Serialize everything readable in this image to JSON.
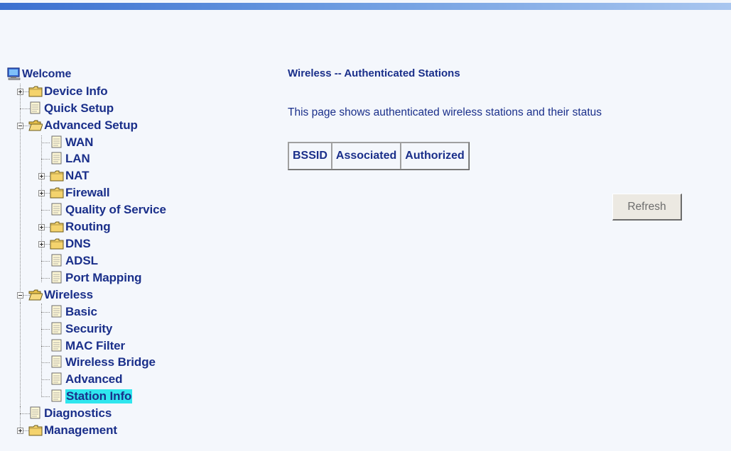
{
  "header": {
    "accent_color": "#3a6fd0"
  },
  "nav_tree": {
    "items": [
      {
        "label": "Welcome",
        "icon": "computer-icon"
      },
      {
        "label": "Device Info",
        "icon": "folder-icon",
        "expander": "plus"
      },
      {
        "label": "Quick Setup",
        "icon": "document-icon"
      },
      {
        "label": "Advanced Setup",
        "icon": "open-folder-icon",
        "expander": "minus"
      },
      {
        "label": "WAN",
        "icon": "document-icon"
      },
      {
        "label": "LAN",
        "icon": "document-icon"
      },
      {
        "label": "NAT",
        "icon": "folder-icon",
        "expander": "plus"
      },
      {
        "label": "Firewall",
        "icon": "folder-icon",
        "expander": "plus"
      },
      {
        "label": "Quality of Service",
        "icon": "document-icon"
      },
      {
        "label": "Routing",
        "icon": "folder-icon",
        "expander": "plus"
      },
      {
        "label": "DNS",
        "icon": "folder-icon",
        "expander": "plus"
      },
      {
        "label": "ADSL",
        "icon": "document-icon"
      },
      {
        "label": "Port Mapping",
        "icon": "document-icon"
      },
      {
        "label": "Wireless",
        "icon": "open-folder-icon",
        "expander": "minus"
      },
      {
        "label": "Basic",
        "icon": "document-icon"
      },
      {
        "label": "Security",
        "icon": "document-icon"
      },
      {
        "label": "MAC Filter",
        "icon": "document-icon"
      },
      {
        "label": "Wireless Bridge",
        "icon": "document-icon"
      },
      {
        "label": "Advanced",
        "icon": "document-icon"
      },
      {
        "label": "Station Info",
        "icon": "document-icon",
        "selected": true
      },
      {
        "label": "Diagnostics",
        "icon": "document-icon"
      },
      {
        "label": "Management",
        "icon": "folder-icon",
        "expander": "plus"
      }
    ],
    "selected_highlight_color": "#2fe6ee"
  },
  "main": {
    "title": "Wireless -- Authenticated Stations",
    "description": "This page shows authenticated wireless stations and their status",
    "table": {
      "headers": [
        "BSSID",
        "Associated",
        "Authorized"
      ],
      "rows": []
    },
    "refresh_label": "Refresh"
  }
}
